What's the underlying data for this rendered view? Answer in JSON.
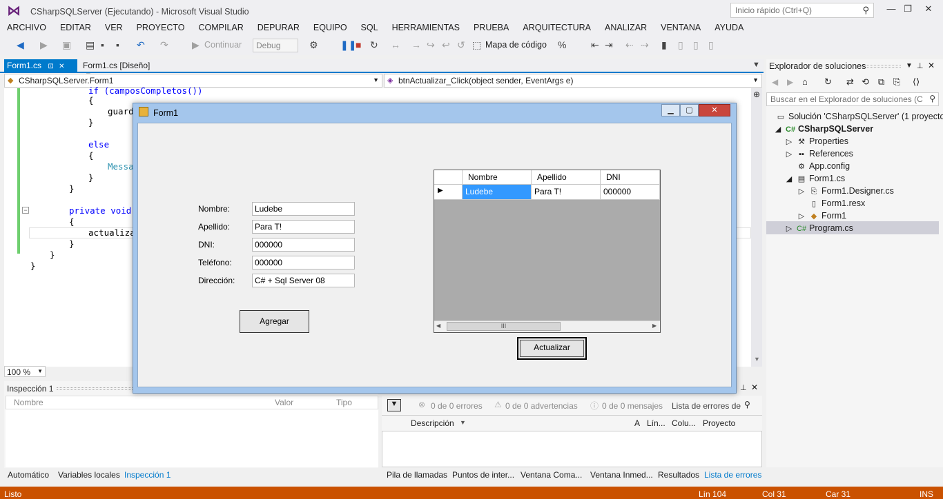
{
  "window": {
    "title": "CSharpSQLServer (Ejecutando) - Microsoft Visual Studio",
    "quick_launch_placeholder": "Inicio rápido (Ctrl+Q)"
  },
  "menu": [
    "ARCHIVO",
    "EDITAR",
    "VER",
    "PROYECTO",
    "COMPILAR",
    "DEPURAR",
    "EQUIPO",
    "SQL",
    "HERRAMIENTAS",
    "PRUEBA",
    "ARQUITECTURA",
    "ANALIZAR",
    "VENTANA",
    "AYUDA"
  ],
  "toolbar": {
    "continue_label": "Continuar",
    "config_value": "Debug",
    "code_map_label": "Mapa de código"
  },
  "tabs": {
    "active": "Form1.cs",
    "design": "Form1.cs [Diseño]"
  },
  "nav": {
    "class_combo": "CSharpSQLServer.Form1",
    "member_combo": "btnActualizar_Click(object sender, EventArgs e)"
  },
  "code": {
    "l1": "if (camposCompletos())",
    "l2": "{",
    "l3": "guard",
    "l4": "}",
    "l5": "else",
    "l6": "{",
    "l7": "Messa",
    "l8": "}",
    "l9": "}",
    "l10_kw": "private void",
    "l11": "{",
    "l12": "actualiza",
    "l13": "}",
    "l14": "}",
    "l15": "}"
  },
  "zoom": "100 %",
  "watch": {
    "title": "Inspección 1",
    "col_name": "Nombre",
    "col_value": "Valor",
    "col_type": "Tipo"
  },
  "errors": {
    "errors_label": "0 de 0 errores",
    "warnings_label": "0 de 0 advertencias",
    "messages_label": "0 de 0 mensajes",
    "source_combo": "Lista de errores de",
    "col_desc": "Descripción",
    "col_a": "A",
    "col_line": "Lín...",
    "col_col": "Colu...",
    "col_project": "Proyecto"
  },
  "bottom_tabs_left": [
    "Automático",
    "Variables locales",
    "Inspección 1"
  ],
  "bottom_tabs_right": [
    "Pila de llamadas",
    "Puntos de inter...",
    "Ventana Coma...",
    "Ventana Inmed...",
    "Resultados",
    "Lista de errores"
  ],
  "status": {
    "ready": "Listo",
    "line": "Lín 104",
    "col": "Col 31",
    "car": "Car 31",
    "mode": "INS"
  },
  "solution_explorer": {
    "title": "Explorador de soluciones",
    "search_placeholder": "Buscar en el Explorador de soluciones (C",
    "items": [
      "Solución 'CSharpSQLServer' (1 proyecto)",
      "CSharpSQLServer",
      "Properties",
      "References",
      "App.config",
      "Form1.cs",
      "Form1.Designer.cs",
      "Form1.resx",
      "Form1",
      "Program.cs"
    ]
  },
  "form1": {
    "title": "Form1",
    "labels": {
      "nombre": "Nombre:",
      "apellido": "Apellido:",
      "dni": "DNI:",
      "telefono": "Teléfono:",
      "direccion": "Dirección:"
    },
    "values": {
      "nombre": "Ludebe",
      "apellido": "Para T!",
      "dni": "000000",
      "telefono": "000000",
      "direccion": "C# + Sql Server 08"
    },
    "add_button": "Agregar",
    "update_button": "Actualizar",
    "grid": {
      "columns": [
        "Nombre",
        "Apellido",
        "DNI"
      ],
      "rows": [
        [
          "Ludebe",
          "Para T!",
          "000000"
        ]
      ],
      "hscroll_thumb_glyph": "III"
    }
  },
  "colors": {
    "accent": "#007acc",
    "status_bar": "#ca5100",
    "grid_selected": "#3399ff"
  }
}
